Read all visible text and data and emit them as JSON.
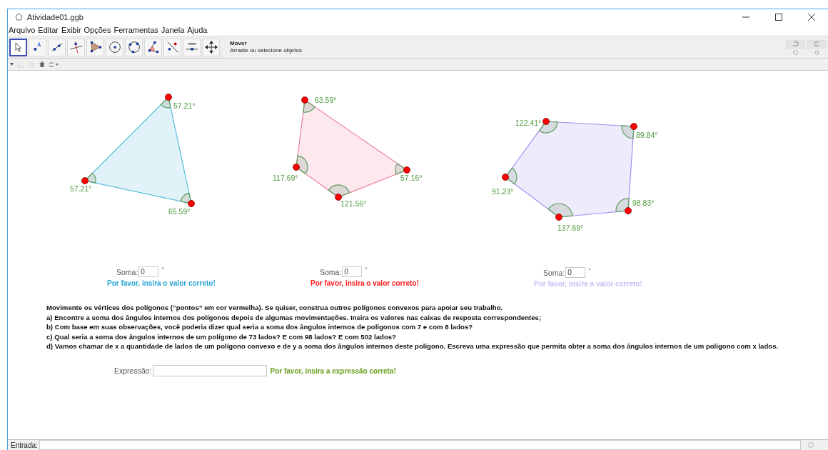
{
  "window": {
    "title": "Atividade01.ggb"
  },
  "menu": [
    "Arquivo",
    "Editar",
    "Exibir",
    "Opções",
    "Ferramentas",
    "Janela",
    "Ajuda"
  ],
  "toolbar": {
    "tools": [
      {
        "kind": "move",
        "selected": true
      },
      {
        "kind": "point",
        "selected": false
      },
      {
        "kind": "line",
        "selected": false
      },
      {
        "kind": "perpendicular",
        "selected": false
      },
      {
        "kind": "polygon",
        "selected": false
      },
      {
        "kind": "circle",
        "selected": false
      },
      {
        "kind": "circle3",
        "selected": false
      },
      {
        "kind": "angle",
        "selected": false
      },
      {
        "kind": "reflect",
        "selected": false
      },
      {
        "kind": "slider",
        "selected": false
      },
      {
        "kind": "pan",
        "selected": false
      }
    ],
    "tool_name": "Mover",
    "tool_hint": "Arraste ou selecione objetos"
  },
  "polygons": [
    {
      "color": "#5bbcdc",
      "angle_labels": [
        "57.21°",
        "57.21°",
        "65.59°"
      ]
    },
    {
      "color": "#f0809c",
      "angle_labels": [
        "63.59°",
        "117.69°",
        "121.56°",
        "57.16°"
      ]
    },
    {
      "color": "#a390ee",
      "angle_labels": [
        "122.41°",
        "89.84°",
        "98.83°",
        "137.69°",
        "91.23°"
      ]
    }
  ],
  "answers": [
    {
      "label": "Soma:",
      "value": "0",
      "unit": "°",
      "feedback": "Por favor, insira o valor correto!",
      "color": "#25a4d6"
    },
    {
      "label": "Soma:",
      "value": "0",
      "unit": "°",
      "feedback": "Por favor, insira o valor correto!",
      "color": "#ff1a1a"
    },
    {
      "label": "Soma:",
      "value": "0",
      "unit": "°",
      "feedback": "Por favor, insira o valor correto!",
      "color": "#c8c0f6"
    }
  ],
  "instructions": [
    "Movimente os vértices dos polígonos (“pontos” em cor vermelha). Se quiser, construa outros polígonos convexos para apoiar seu trabalho.",
    "a) Encontre a soma dos ângulos internos dos polígonos depois de algumas movimentações. Insira os valores nas caixas de resposta correspondentes;",
    "b) Com base em suas observações, você poderia dizer qual seria a soma dos ângulos internos de polígonos com 7 e com 8 lados?",
    "c) Qual seria a soma dos ângulos internos de um polígono de 73 lados? E com 98 lados? E com 502 lados?",
    "d) Vamos chamar de x a quantidade de lados de um polígono convexo e de y a soma dos ângulos internos deste polígono. Escreva uma expressão que permita obter a soma dos ângulos internos de um polígono com x lados."
  ],
  "expression": {
    "label": "Expressão:",
    "feedback": "Por favor, insira a expressão correta!",
    "color": "#6a9f1c"
  },
  "input_bar": {
    "label": "Entrada:"
  }
}
